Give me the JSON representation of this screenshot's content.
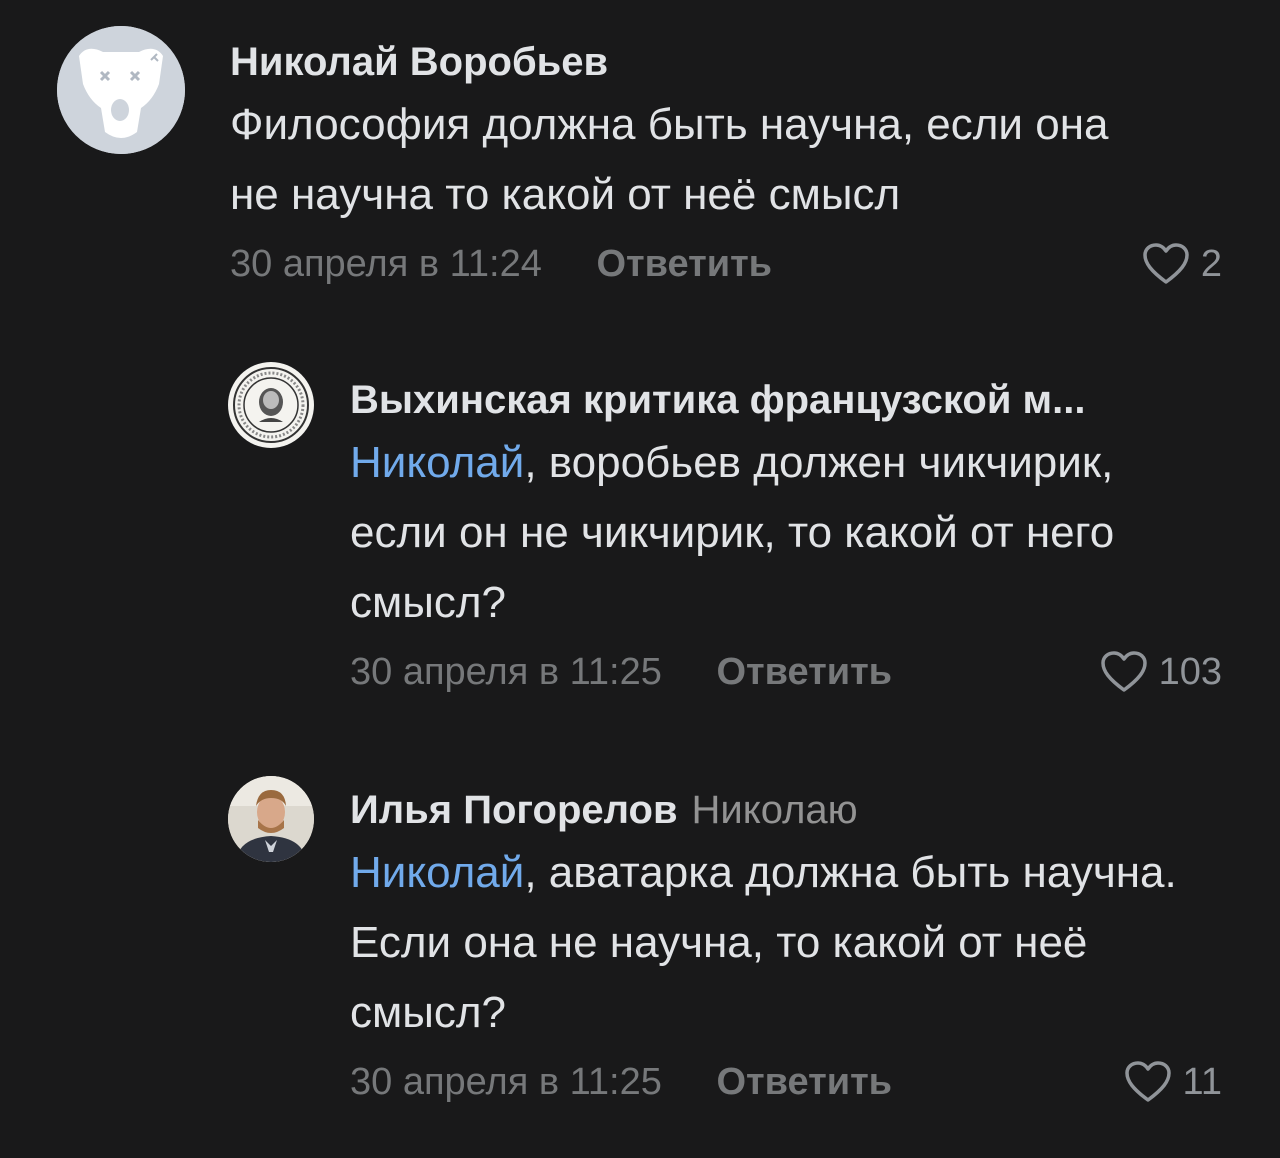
{
  "comments": [
    {
      "author": "Николай Воробьев",
      "reply_to": "",
      "mention": "",
      "text": "Философия должна быть научна, если она не научна то какой от неё смысл",
      "date": "30 апреля в 11:24",
      "reply_label": "Ответить",
      "likes": "2",
      "avatar": "vk-deactivated-dog-avatar"
    },
    {
      "author": "Выхинская критика французской м...",
      "reply_to": "",
      "mention": "Николай",
      "text": ", воробьев должен чикчирик, если он не чикчирик, то какой от него смысл?",
      "date": "30 апреля в 11:25",
      "reply_label": "Ответить",
      "likes": "103",
      "avatar": "round-seal-portrait-avatar"
    },
    {
      "author": "Илья Погорелов",
      "reply_to": "Николаю",
      "mention": "Николай",
      "text": ", аватарка должна быть научна. Если она не научна, то какой от неё смысл?",
      "date": "30 апреля в 11:25",
      "reply_label": "Ответить",
      "likes": "11",
      "avatar": "user-photo-avatar"
    }
  ],
  "colors": {
    "background": "#19191a",
    "text": "#e1e3e6",
    "secondary": "#76787a",
    "mention": "#71aaeb"
  }
}
